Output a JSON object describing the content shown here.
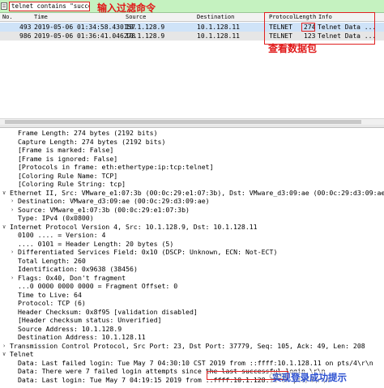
{
  "filter": {
    "value": "telnet contains \"success\"",
    "note": "输入过滤命令"
  },
  "packet_list": {
    "columns": [
      "No.",
      "Time",
      "Source",
      "Destination",
      "Protocol",
      "Length",
      "Info"
    ],
    "rows": [
      {
        "no": "493",
        "time": "2019-05-06 01:34:58.430157",
        "source": "10.1.128.9",
        "destination": "10.1.128.11",
        "protocol": "TELNET",
        "length": "274",
        "info": "Telnet Data ..."
      },
      {
        "no": "986",
        "time": "2019-05-06 01:36:41.046278",
        "source": "10.1.128.9",
        "destination": "10.1.128.11",
        "protocol": "TELNET",
        "length": "123",
        "info": "Telnet Data ..."
      }
    ],
    "note": "查看数据包"
  },
  "details": [
    {
      "indent": 2,
      "arrow": "",
      "text": "Frame Length: 274 bytes (2192 bits)"
    },
    {
      "indent": 2,
      "arrow": "",
      "text": "Capture Length: 274 bytes (2192 bits)"
    },
    {
      "indent": 2,
      "arrow": "",
      "text": "[Frame is marked: False]"
    },
    {
      "indent": 2,
      "arrow": "",
      "text": "[Frame is ignored: False]"
    },
    {
      "indent": 2,
      "arrow": "",
      "text": "[Protocols in frame: eth:ethertype:ip:tcp:telnet]"
    },
    {
      "indent": 2,
      "arrow": "",
      "text": "[Coloring Rule Name: TCP]"
    },
    {
      "indent": 2,
      "arrow": "",
      "text": "[Coloring Rule String: tcp]"
    },
    {
      "indent": 0,
      "arrow": "v",
      "text": "Ethernet II, Src: VMware_e1:07:3b (00:0c:29:e1:07:3b), Dst: VMware_d3:09:ae (00:0c:29:d3:09:ae)"
    },
    {
      "indent": 1,
      "arrow": ">",
      "text": "Destination: VMware_d3:09:ae (00:0c:29:d3:09:ae)"
    },
    {
      "indent": 1,
      "arrow": ">",
      "text": "Source: VMware_e1:07:3b (00:0c:29:e1:07:3b)"
    },
    {
      "indent": 2,
      "arrow": "",
      "text": "Type: IPv4 (0x0800)"
    },
    {
      "indent": 0,
      "arrow": "v",
      "text": "Internet Protocol Version 4, Src: 10.1.128.9, Dst: 10.1.128.11"
    },
    {
      "indent": 2,
      "arrow": "",
      "text": "0100 .... = Version: 4"
    },
    {
      "indent": 2,
      "arrow": "",
      "text": ".... 0101 = Header Length: 20 bytes (5)"
    },
    {
      "indent": 1,
      "arrow": ">",
      "text": "Differentiated Services Field: 0x10 (DSCP: Unknown, ECN: Not-ECT)"
    },
    {
      "indent": 2,
      "arrow": "",
      "text": "Total Length: 260"
    },
    {
      "indent": 2,
      "arrow": "",
      "text": "Identification: 0x9638 (38456)"
    },
    {
      "indent": 1,
      "arrow": ">",
      "text": "Flags: 0x40, Don't fragment"
    },
    {
      "indent": 2,
      "arrow": "",
      "text": "...0 0000 0000 0000 = Fragment Offset: 0"
    },
    {
      "indent": 2,
      "arrow": "",
      "text": "Time to Live: 64"
    },
    {
      "indent": 2,
      "arrow": "",
      "text": "Protocol: TCP (6)"
    },
    {
      "indent": 2,
      "arrow": "",
      "text": "Header Checksum: 0x8f95 [validation disabled]"
    },
    {
      "indent": 2,
      "arrow": "",
      "text": "[Header checksum status: Unverified]"
    },
    {
      "indent": 2,
      "arrow": "",
      "text": "Source Address: 10.1.128.9"
    },
    {
      "indent": 2,
      "arrow": "",
      "text": "Destination Address: 10.1.128.11"
    },
    {
      "indent": 0,
      "arrow": ">",
      "text": "Transmission Control Protocol, Src Port: 23, Dst Port: 37779, Seq: 105, Ack: 49, Len: 208"
    },
    {
      "indent": 0,
      "arrow": "v",
      "text": "Telnet"
    },
    {
      "indent": 2,
      "arrow": "",
      "text": "Data: Last failed login: Tue May  7 04:30:10 CST 2019 from ::ffff:10.1.128.11 on pts/4\\r\\n"
    },
    {
      "indent": 2,
      "arrow": "",
      "text": "Data: There were 7 failed login attempts since the last successful login.\\r\\n"
    },
    {
      "indent": 2,
      "arrow": "",
      "text": "Data: Last login: Tue May  7 04:19:15 2019 from ::ffff:10.1.128.11 on pts/4\\r\\n"
    }
  ],
  "login_note": "实现登录成功提示",
  "watermark": "CSD"
}
